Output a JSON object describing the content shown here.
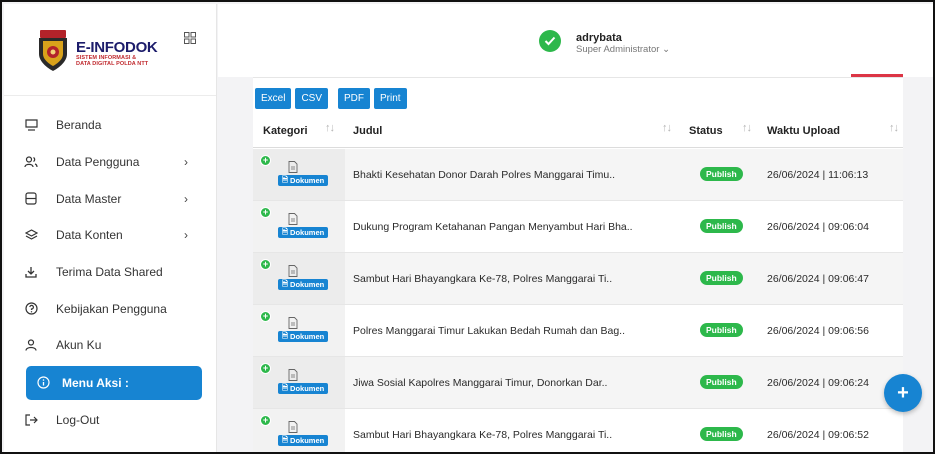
{
  "brand": {
    "title": "E-INFODOK",
    "subtitle_line1": "SISTEM INFORMASI &",
    "subtitle_line2": "DATA DIGITAL POLDA NTT",
    "primary_color": "#1784d2"
  },
  "user": {
    "name": "adrybata",
    "role": "Super Administrator ⌄"
  },
  "sidebar": {
    "items": [
      {
        "label": "Beranda",
        "icon": "monitor-icon",
        "has_submenu": false
      },
      {
        "label": "Data Pengguna",
        "icon": "users-icon",
        "has_submenu": true
      },
      {
        "label": "Data Master",
        "icon": "database-icon",
        "has_submenu": true
      },
      {
        "label": "Data Konten",
        "icon": "layers-icon",
        "has_submenu": true
      },
      {
        "label": "Terima Data Shared",
        "icon": "download-icon",
        "has_submenu": false
      },
      {
        "label": "Kebijakan Pengguna",
        "icon": "help-circle-icon",
        "has_submenu": false
      },
      {
        "label": "Akun Ku",
        "icon": "user-icon",
        "has_submenu": false
      },
      {
        "label": "Menu Aksi :",
        "icon": "info-icon",
        "has_submenu": false,
        "active": true
      },
      {
        "label": "Log-Out",
        "icon": "logout-icon",
        "has_submenu": false
      }
    ],
    "chevron": "›"
  },
  "toolbar": {
    "excel": "Excel",
    "csv": "CSV",
    "pdf": "PDF",
    "print": "Print"
  },
  "table": {
    "columns": [
      "Kategori",
      "Judul",
      "Status",
      "Waktu Upload"
    ],
    "badge_label": "Dokumen",
    "rows": [
      {
        "judul": "Bhakti Kesehatan Donor Darah Polres Manggarai Timu..",
        "status": "Publish",
        "waktu": "26/06/2024 | 11:06:13"
      },
      {
        "judul": "Dukung Program Ketahanan Pangan Menyambut Hari Bha..",
        "status": "Publish",
        "waktu": "26/06/2024 | 09:06:04"
      },
      {
        "judul": "Sambut Hari Bhayangkara Ke-78, Polres Manggarai Ti..",
        "status": "Publish",
        "waktu": "26/06/2024 | 09:06:47"
      },
      {
        "judul": "Polres Manggarai Timur Lakukan Bedah Rumah dan Bag..",
        "status": "Publish",
        "waktu": "26/06/2024 | 09:06:56"
      },
      {
        "judul": "Jiwa Sosial Kapolres Manggarai Timur, Donorkan Dar..",
        "status": "Publish",
        "waktu": "26/06/2024 | 09:06:24"
      },
      {
        "judul": "Sambut Hari Bhayangkara Ke-78, Polres Manggarai Ti..",
        "status": "Publish",
        "waktu": "26/06/2024 | 09:06:52"
      }
    ]
  },
  "fab": {
    "label": "+"
  }
}
